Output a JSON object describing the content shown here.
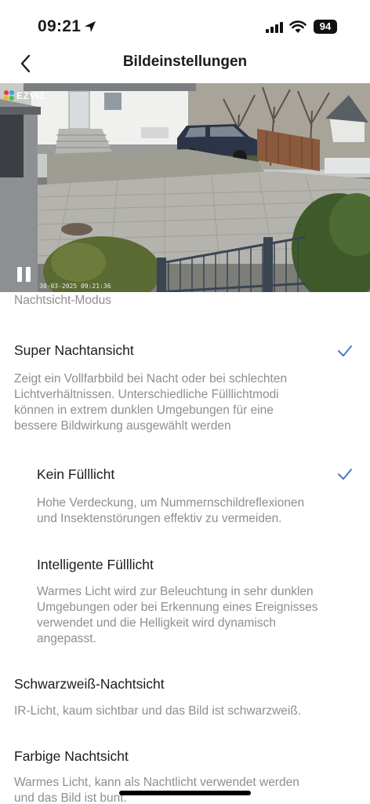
{
  "status_bar": {
    "time": "09:21",
    "battery": "94"
  },
  "nav": {
    "title": "Bildeinstellungen"
  },
  "video": {
    "brand": "EZVIZ",
    "timestamp": "30-03-2025 09:21:36"
  },
  "settings": {
    "section_label": "Nachtsicht-Modus",
    "options": [
      {
        "title": "Super Nachtansicht",
        "selected": true,
        "description_lines": [
          "Zeigt ein Vollfarbbild bei Nacht oder bei schlechten",
          "Lichtverhältnissen. Unterschiedliche Fülllichtmodi",
          "können in extrem dunklen Umgebungen für eine",
          "bessere Bildwirkung ausgewählt werden"
        ]
      },
      {
        "title": "Kein Fülllicht",
        "selected": true,
        "description_lines": [
          "Hohe Verdeckung, um Nummernschildreflexionen",
          "und Insektenstörungen effektiv zu vermeiden."
        ]
      },
      {
        "title": "Intelligente Fülllicht",
        "selected": false,
        "description_lines": [
          "Warmes Licht wird zur Beleuchtung in sehr dunklen",
          "Umgebungen oder bei Erkennung eines Ereignisses",
          "verwendet und die Helligkeit wird dynamisch",
          "angepasst."
        ]
      },
      {
        "title": "Schwarzweiß-Nachtsicht",
        "selected": false,
        "description_lines": [
          "IR-Licht, kaum sichtbar und das Bild ist schwarzweiß."
        ]
      },
      {
        "title": "Farbige Nachtsicht",
        "selected": false,
        "description_lines": [
          "Warmes Licht, kann als Nachtlicht verwendet werden",
          "und das Bild ist bunt."
        ]
      }
    ]
  },
  "colors": {
    "accent_check": "#4a78c8",
    "secondary_text": "#8e8e93"
  }
}
